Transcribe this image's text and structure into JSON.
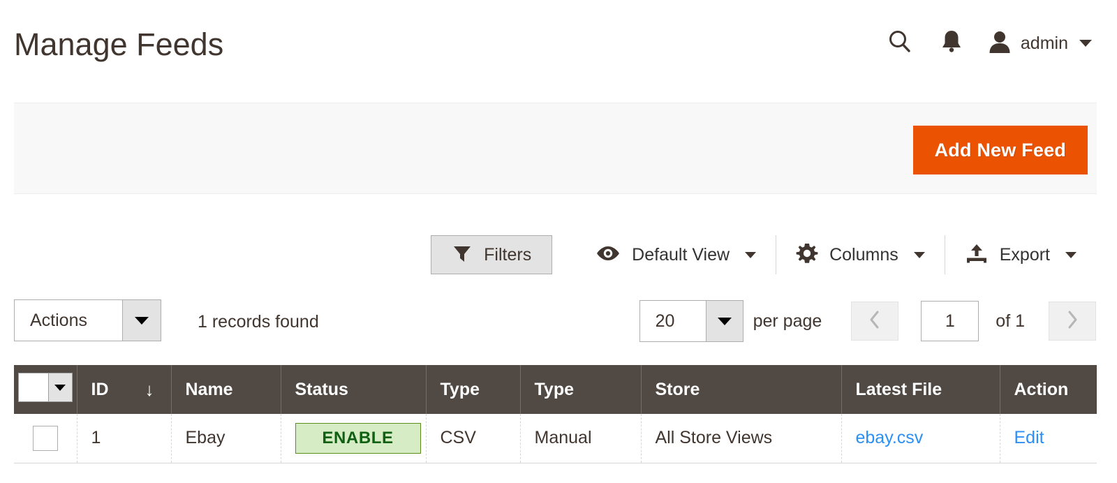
{
  "header": {
    "title": "Manage Feeds",
    "search_icon": "search-icon",
    "notifications_icon": "bell-icon",
    "user_icon": "user-avatar-icon",
    "user_name": "admin"
  },
  "actions_panel": {
    "add_new_feed_label": "Add New Feed",
    "accent_color": "#eb5202"
  },
  "toolbar": {
    "filters_label": "Filters",
    "filters_icon": "funnel-icon",
    "view_icon": "eye-icon",
    "view_label": "Default View",
    "columns_icon": "gear-icon",
    "columns_label": "Columns",
    "export_icon": "upload-icon",
    "export_label": "Export"
  },
  "controls": {
    "actions_label": "Actions",
    "records_found": "1 records found",
    "per_page_value": "20",
    "per_page_label": "per page",
    "prev_icon": "chevron-left-icon",
    "next_icon": "chevron-right-icon",
    "page_value": "1",
    "page_total": "of 1"
  },
  "grid": {
    "select_all_icon": "checkbox-dropdown",
    "columns": [
      {
        "label": "ID",
        "sorted": true,
        "sort_icon": "↓"
      },
      {
        "label": "Name"
      },
      {
        "label": "Status"
      },
      {
        "label": "Type"
      },
      {
        "label": "Type"
      },
      {
        "label": "Store"
      },
      {
        "label": "Latest File"
      },
      {
        "label": "Action"
      }
    ],
    "rows": [
      {
        "id": "1",
        "name": "Ebay",
        "status": "ENABLE",
        "status_color": "#0f6012",
        "status_bg": "#d6ecc5",
        "type": "CSV",
        "type2": "Manual",
        "store": "All Store Views",
        "latest_file": "ebay.csv",
        "action": "Edit"
      }
    ]
  }
}
